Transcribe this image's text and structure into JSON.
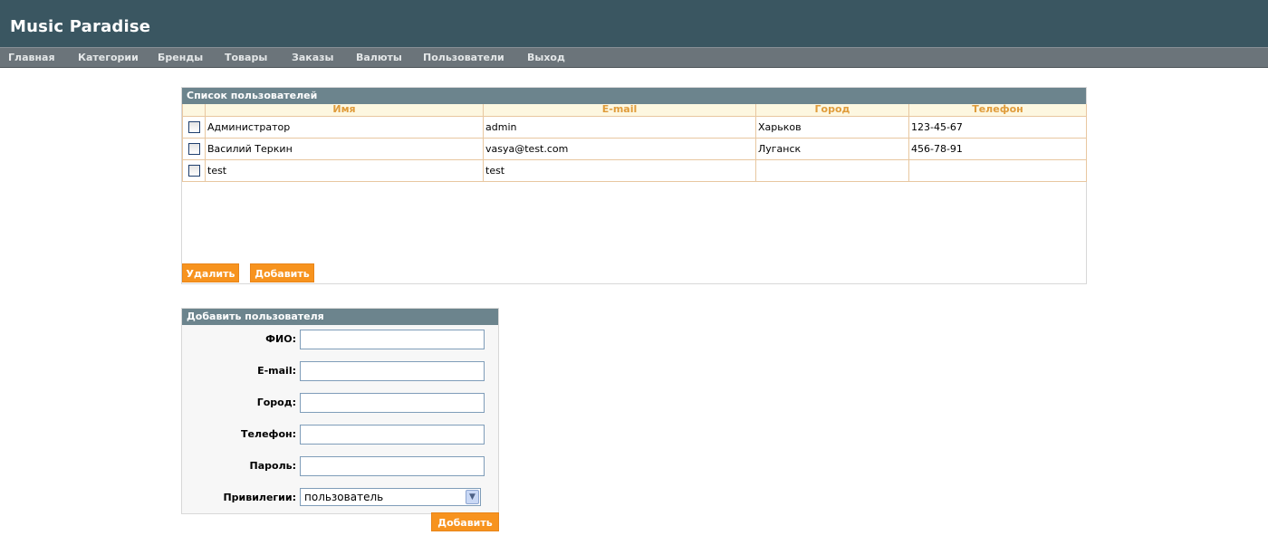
{
  "app": {
    "title": "Music Paradise"
  },
  "nav": {
    "items": [
      {
        "label": "Главная"
      },
      {
        "label": "Категории"
      },
      {
        "label": "Бренды"
      },
      {
        "label": "Товары"
      },
      {
        "label": "Заказы"
      },
      {
        "label": "Валюты"
      },
      {
        "label": "Пользователи"
      },
      {
        "label": "Выход"
      }
    ]
  },
  "users_panel": {
    "title": "Список пользователей",
    "columns": [
      "Имя",
      "E-mail",
      "Город",
      "Телефон"
    ],
    "rows": [
      {
        "name": "Администратор",
        "email": "admin",
        "city": "Харьков",
        "phone": "123-45-67",
        "checked": false
      },
      {
        "name": "Василий Теркин",
        "email": "vasya@test.com",
        "city": "Луганск",
        "phone": "456-78-91",
        "checked": false
      },
      {
        "name": "test",
        "email": "test",
        "city": "",
        "phone": "",
        "checked": false
      }
    ],
    "delete_label": "Удалить",
    "add_label": "Добавить"
  },
  "add_panel": {
    "title": "Добавить пользователя",
    "fields": [
      {
        "label": "ФИО:",
        "value": ""
      },
      {
        "label": "E-mail:",
        "value": ""
      },
      {
        "label": "Город:",
        "value": ""
      },
      {
        "label": "Телефон:",
        "value": ""
      },
      {
        "label": "Пароль:",
        "value": ""
      }
    ],
    "privileges_label": "Привилегии:",
    "privileges_value": "пользователь",
    "submit_label": "Добавить"
  },
  "colors": {
    "header_bg": "#3a5661",
    "nav_bg": "#6b747a",
    "panel_head_bg": "#6c848d",
    "button_bg": "#f7931e",
    "column_header_text": "#e09c3b"
  }
}
